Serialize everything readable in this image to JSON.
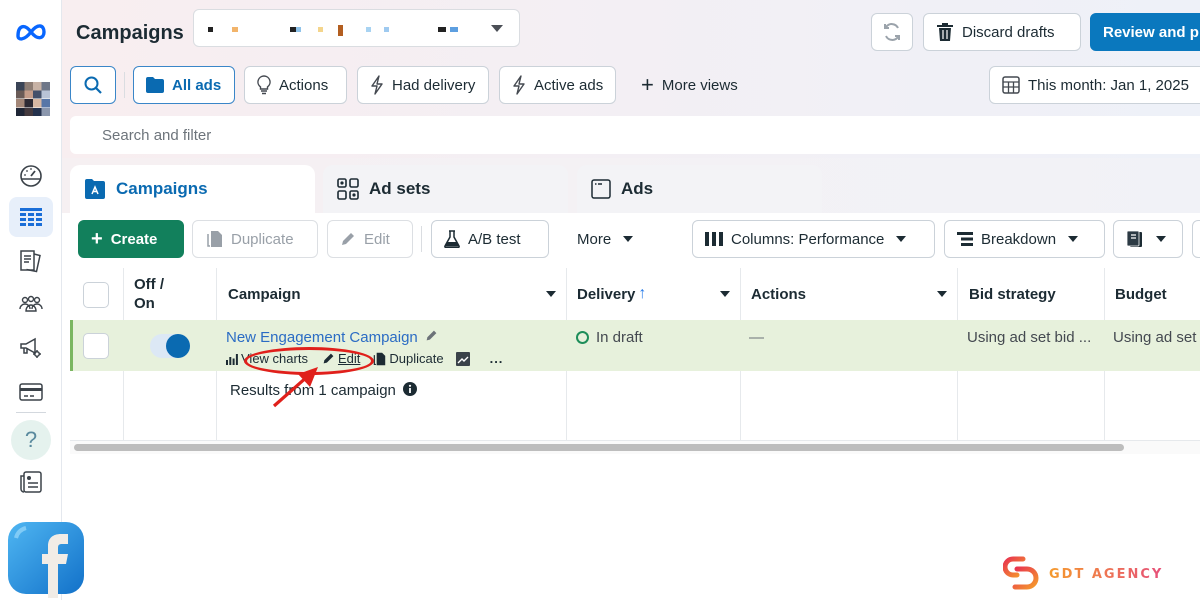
{
  "app": {
    "title": "Campaigns",
    "account_selector": {
      "value": "(blurred account name)"
    }
  },
  "header_actions": {
    "refresh_label": "Refresh",
    "discard_drafts": "Discard drafts",
    "review_publish": "Review and p"
  },
  "views": {
    "search_label": "Search",
    "items": [
      {
        "label": "All ads",
        "icon": "folder-icon",
        "selected": true
      },
      {
        "label": "Actions",
        "icon": "lightbulb-icon",
        "selected": false
      },
      {
        "label": "Had delivery",
        "icon": "lightning-icon",
        "selected": false
      },
      {
        "label": "Active ads",
        "icon": "lightning-icon",
        "selected": false
      }
    ],
    "more_views": "More views",
    "date_range": "This month: Jan 1, 2025"
  },
  "search": {
    "placeholder": "Search and filter"
  },
  "tabs": [
    {
      "label": "Campaigns",
      "icon": "campaign-folder-icon",
      "active": true
    },
    {
      "label": "Ad sets",
      "icon": "grid-icon",
      "active": false
    },
    {
      "label": "Ads",
      "icon": "ad-window-icon",
      "active": false
    }
  ],
  "toolbar": {
    "create": "Create",
    "duplicate": "Duplicate",
    "edit": "Edit",
    "ab_test": "A/B test",
    "more": "More",
    "columns": "Columns: Performance",
    "breakdown": "Breakdown",
    "reports_icon": "reports-icon"
  },
  "table": {
    "headers": {
      "toggle": "Off / On",
      "campaign": "Campaign",
      "delivery": "Delivery",
      "delivery_sort": "ascending",
      "actions": "Actions",
      "bid_strategy": "Bid strategy",
      "budget": "Budget"
    },
    "rows": [
      {
        "selected": false,
        "on": true,
        "campaign": "New Engagement Campaign",
        "row_actions": {
          "view_charts": "View charts",
          "edit": "Edit",
          "duplicate": "Duplicate",
          "more": "..."
        },
        "delivery": "In draft",
        "actions": "—",
        "bid_strategy": "Using ad set bid ...",
        "budget": "Using ad set"
      }
    ],
    "summary": "Results from 1 campaign"
  },
  "sidebar": {
    "items": [
      {
        "name": "account-overview",
        "icon": "gauge-icon",
        "active": false
      },
      {
        "name": "campaigns",
        "icon": "table-icon",
        "active": true
      },
      {
        "name": "reporting",
        "icon": "documents-icon",
        "active": false
      },
      {
        "name": "audiences",
        "icon": "people-icon",
        "active": false
      },
      {
        "name": "advertising-settings",
        "icon": "megaphone-icon",
        "active": false
      },
      {
        "name": "billing",
        "icon": "credit-card-icon",
        "active": false
      },
      {
        "name": "help",
        "icon": "help-icon",
        "active": false
      },
      {
        "name": "news",
        "icon": "newspaper-icon",
        "active": false
      }
    ]
  },
  "watermark": {
    "brand": "GDT AGENCY"
  },
  "colors": {
    "brand_blue": "#0a78be",
    "create_green": "#12805c",
    "selected_row": "#e7f1dc",
    "link_blue": "#2b6cc4",
    "annotation_red": "#e0201b",
    "delivery_status": "#1e8e5a"
  }
}
